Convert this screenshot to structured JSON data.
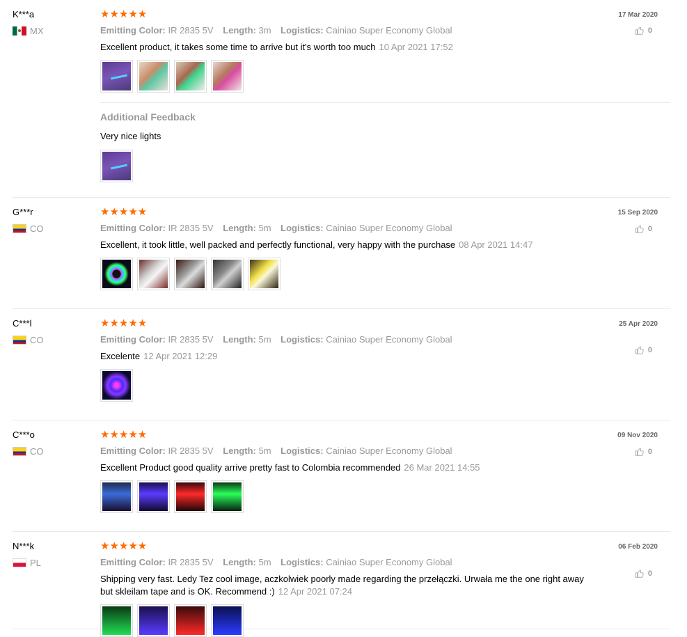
{
  "attr_labels": {
    "color": "Emitting Color:",
    "length": "Length:",
    "logistics": "Logistics:"
  },
  "additional_feedback_label": "Additional Feedback",
  "star_glyph": "★★★★★",
  "reviews": [
    {
      "user": "K***a",
      "country": "MX",
      "flag": "mx",
      "rating": 5,
      "color": "IR 2835 5V",
      "length": "3m",
      "logistics": "Cainiao Super Economy Global",
      "text": "Excellent product, it takes some time to arrive but it's worth too much",
      "timestamp": "10 Apr 2021 17:52",
      "date": "17 Mar 2020",
      "likes": "0",
      "images": [
        "g-purple-line",
        "g-hand1",
        "g-hand2",
        "g-hand3"
      ],
      "additional": {
        "text": "Very nice lights",
        "images": [
          "g-purple-line"
        ]
      }
    },
    {
      "user": "G***r",
      "country": "CO",
      "flag": "co",
      "rating": 5,
      "color": "IR 2835 5V",
      "length": "5m",
      "logistics": "Cainiao Super Economy Global",
      "text": "Excellent, it took little, well packed and perfectly functional, very happy with the purchase",
      "timestamp": "08 Apr 2021 14:47",
      "date": "15 Sep 2020",
      "likes": "0",
      "images": [
        "g-reel",
        "g-remote",
        "g-bag1",
        "g-bag2",
        "g-yellow"
      ]
    },
    {
      "user": "C***l",
      "country": "CO",
      "flag": "co",
      "rating": 5,
      "color": "IR 2835 5V",
      "length": "5m",
      "logistics": "Cainiao Super Economy Global",
      "text": "Excelente",
      "timestamp": "12 Apr 2021 12:29",
      "date": "25 Apr 2020",
      "likes": "0",
      "images": [
        "g-coil"
      ]
    },
    {
      "user": "C***o",
      "country": "CO",
      "flag": "co",
      "rating": 5,
      "color": "IR 2835 5V",
      "length": "5m",
      "logistics": "Cainiao Super Economy Global",
      "text": "Excellent Product good quality arrive pretty fast to Colombia recommended",
      "timestamp": "26 Mar 2021 14:55",
      "date": "09 Nov 2020",
      "likes": "0",
      "images": [
        "g-tv-blue",
        "g-tv-purple",
        "g-tv-red",
        "g-tv-green"
      ]
    },
    {
      "user": "N***k",
      "country": "PL",
      "flag": "pl",
      "rating": 5,
      "color": "IR 2835 5V",
      "length": "5m",
      "logistics": "Cainiao Super Economy Global",
      "text": "Shipping very fast. Ledy Tez cool image, aczkolwiek poorly made regarding the przełączki. Urwała me the one right away but skleilam tape and is OK. Recommend :)",
      "timestamp": "12 Apr 2021 07:24",
      "date": "06 Feb 2020",
      "likes": "0",
      "images": [
        "g-green",
        "g-violet",
        "g-red",
        "g-blue"
      ]
    }
  ]
}
